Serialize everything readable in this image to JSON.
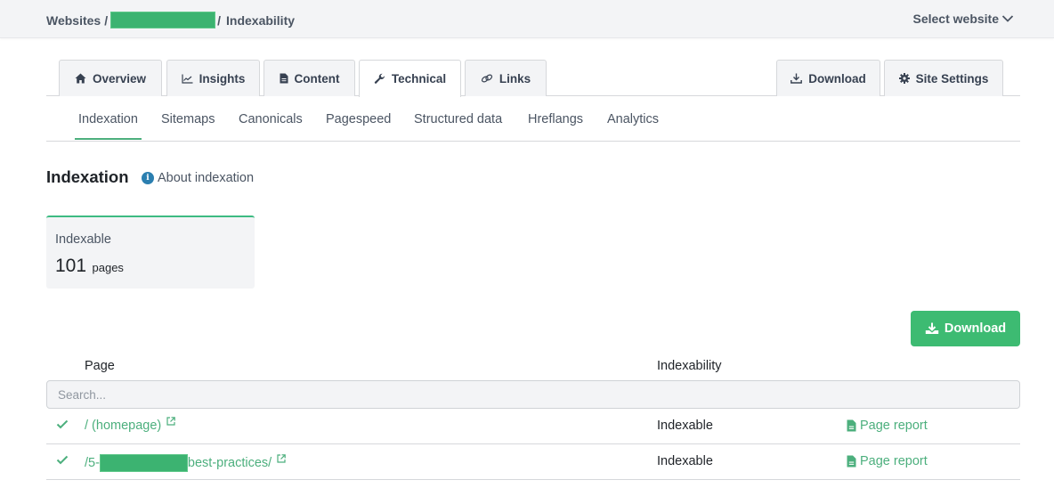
{
  "header": {
    "breadcrumb": {
      "root": "Websites",
      "separator": "/",
      "site": "[redacted]",
      "current": "Indexability"
    },
    "select_website": {
      "label": "Select website",
      "icon": "chevron-down-icon"
    }
  },
  "main_tabs": [
    {
      "label": "Overview",
      "icon": "home-icon",
      "active": false
    },
    {
      "label": "Insights",
      "icon": "chart-line-icon",
      "active": false
    },
    {
      "label": "Content",
      "icon": "file-icon",
      "active": false
    },
    {
      "label": "Technical",
      "icon": "wrench-icon",
      "active": true
    },
    {
      "label": "Links",
      "icon": "link-icon",
      "active": false
    }
  ],
  "right_tabs": [
    {
      "label": "Download",
      "icon": "download-icon"
    },
    {
      "label": "Site Settings",
      "icon": "gear-icon"
    }
  ],
  "sub_tabs": [
    {
      "label": "Indexation",
      "active": true
    },
    {
      "label": "Sitemaps",
      "active": false
    },
    {
      "label": "Canonicals",
      "active": false
    },
    {
      "label": "Pagespeed",
      "active": false
    },
    {
      "label": "Structured data",
      "active": false
    },
    {
      "label": "Hreflangs",
      "active": false
    },
    {
      "label": "Analytics",
      "active": false
    }
  ],
  "section": {
    "title": "Indexation",
    "about_link": "About indexation",
    "about_icon": "info-icon"
  },
  "stat_card": {
    "label": "Indexable",
    "value": "101",
    "unit": "pages"
  },
  "download_button": {
    "label": "Download",
    "icon": "download-icon"
  },
  "table": {
    "columns": [
      "Page",
      "Indexability"
    ],
    "search": {
      "placeholder": "Search...",
      "value": ""
    },
    "rows": [
      {
        "status_icon": "check-icon",
        "page_prefix": "/ (homepage)",
        "page_redacted": false,
        "page_suffix": "",
        "indexability": "Indexable",
        "report_label": "Page report"
      },
      {
        "status_icon": "check-icon",
        "page_prefix": "/5-",
        "page_redacted": true,
        "page_suffix": "best-practices/",
        "indexability": "Indexable",
        "report_label": "Page report"
      }
    ]
  },
  "colors": {
    "accent_green": "#3dbb72",
    "link_green": "#4caf7d",
    "info_blue": "#2b7fb0",
    "topbar_bg": "#f3f4f6",
    "redaction": "#3cb371"
  }
}
